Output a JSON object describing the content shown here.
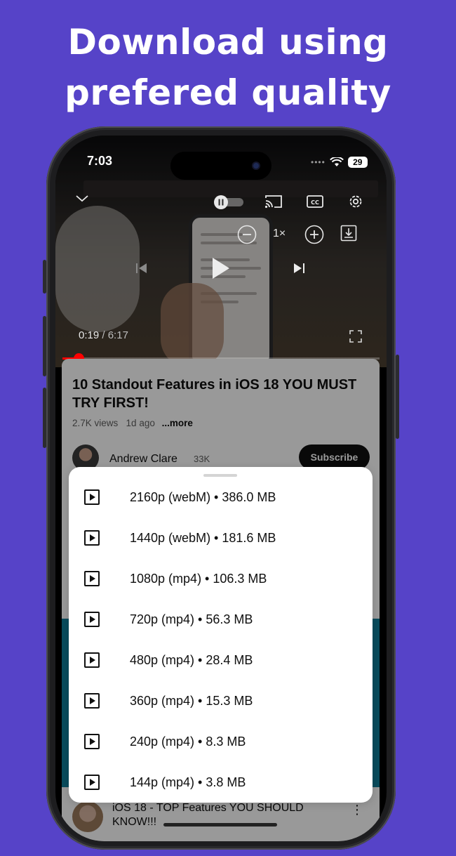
{
  "headline": {
    "line1": "Download using",
    "line2": "prefered quality"
  },
  "status_bar": {
    "time": "7:03",
    "battery": "29"
  },
  "player": {
    "speed": "1×",
    "current_time": "0:19",
    "separator": " / ",
    "duration": "6:17",
    "progress": 0.05,
    "accent_color": "#ff0000"
  },
  "video": {
    "title": "10 Standout Features in iOS 18 YOU MUST TRY FIRST!",
    "views": "2.7K views",
    "age": "1d ago",
    "more": "...more"
  },
  "channel": {
    "name": "Andrew Clare",
    "subscribers": "33K",
    "subscribe_label": "Subscribe"
  },
  "download_sheet": {
    "options": [
      {
        "label": "2160p (webM) • 386.0 MB"
      },
      {
        "label": "1440p (webM) • 181.6 MB"
      },
      {
        "label": "1080p (mp4) • 106.3 MB"
      },
      {
        "label": "720p (mp4) • 56.3 MB"
      },
      {
        "label": "480p (mp4) • 28.4 MB"
      },
      {
        "label": "360p (mp4) • 15.3 MB"
      },
      {
        "label": "240p (mp4) • 8.3 MB"
      },
      {
        "label": "144p (mp4) • 3.8 MB"
      }
    ]
  },
  "next_video": {
    "title": "iOS 18 - TOP Features YOU SHOULD KNOW!!!",
    "menu_icon": "⋮"
  },
  "colors": {
    "background": "#5643c8",
    "sheet": "#ffffff",
    "subscribe_bg": "#0f0f0f"
  }
}
